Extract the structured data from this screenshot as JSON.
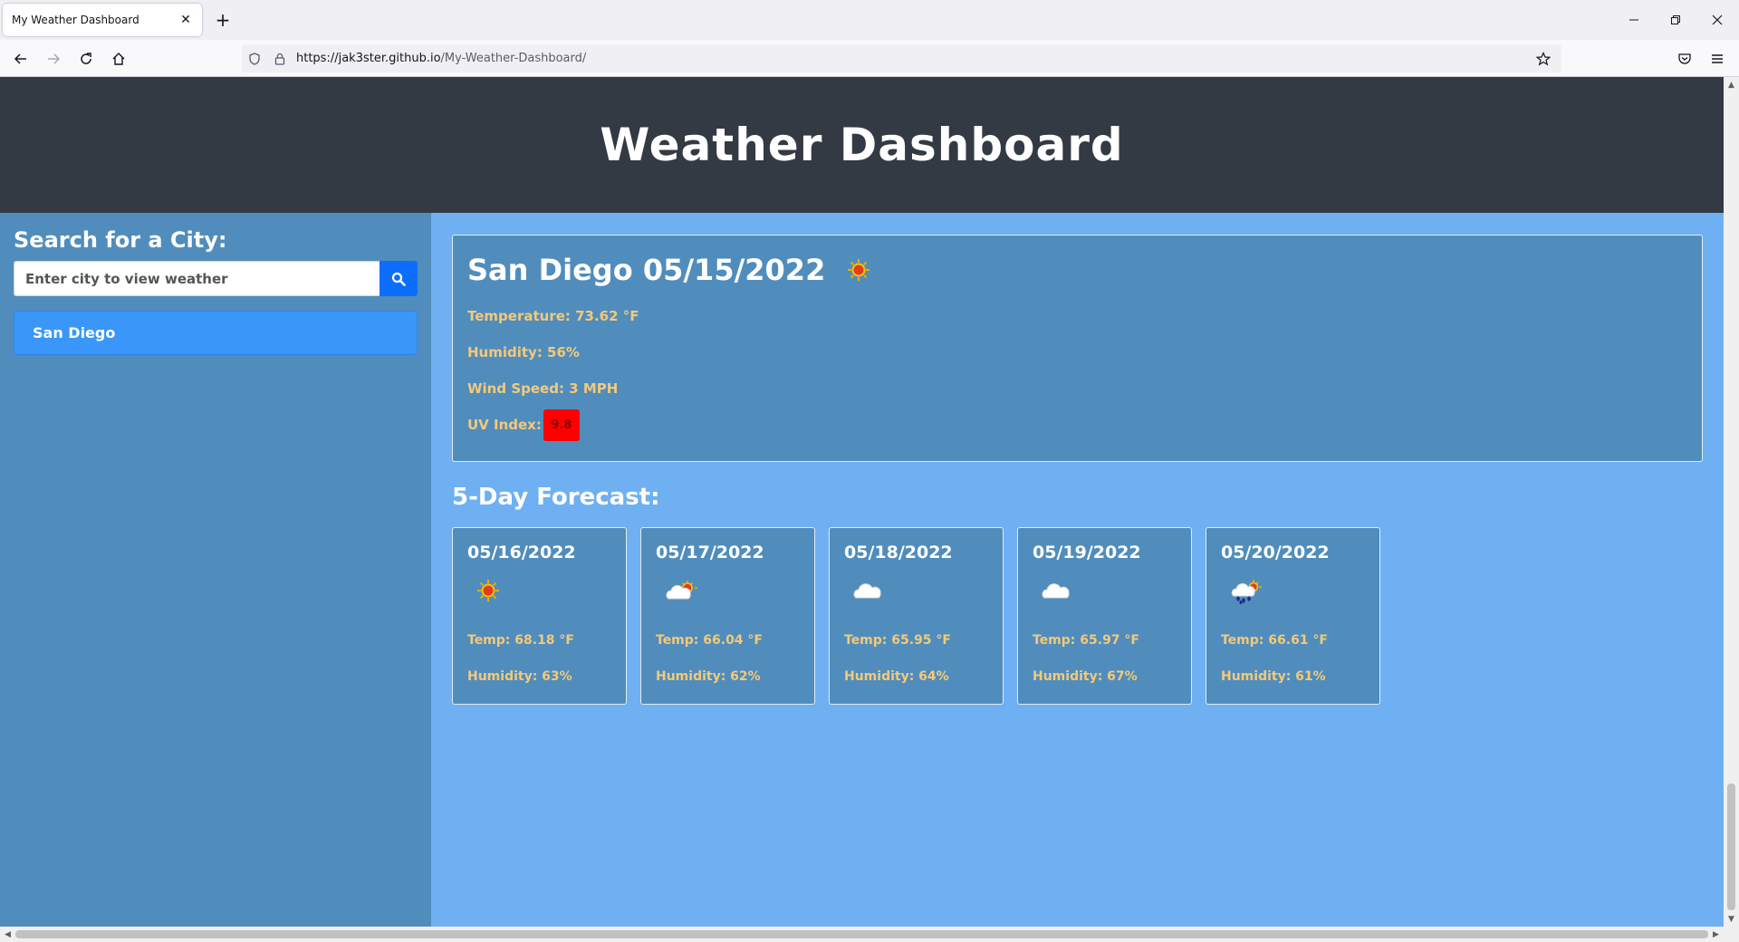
{
  "browser": {
    "tab_title": "My Weather Dashboard",
    "tab_close": "✕",
    "new_tab": "+",
    "url_host": "https://jak3ster.github.io",
    "url_path": "/My-Weather-Dashboard/"
  },
  "header": {
    "title": "Weather Dashboard"
  },
  "sidebar": {
    "heading": "Search for a City:",
    "search_placeholder": "Enter city to view weather",
    "history": [
      "San Diego"
    ]
  },
  "current": {
    "title": "San Diego 05/15/2022",
    "icon": "sun-icon",
    "temperature": "Temperature: 73.62 °F",
    "humidity": "Humidity: 56%",
    "wind": "Wind Speed: 3 MPH",
    "uv_label": "UV Index:",
    "uv_value": "9.8",
    "uv_color": "#ff0000"
  },
  "forecast": {
    "heading": "5-Day Forecast:",
    "days": [
      {
        "date": "05/16/2022",
        "icon": "sun-icon",
        "temp": "Temp: 68.18 °F",
        "humidity": "Humidity: 63%"
      },
      {
        "date": "05/17/2022",
        "icon": "partly-cloudy-icon",
        "temp": "Temp: 66.04 °F",
        "humidity": "Humidity: 62%"
      },
      {
        "date": "05/18/2022",
        "icon": "cloud-icon",
        "temp": "Temp: 65.95 °F",
        "humidity": "Humidity: 64%"
      },
      {
        "date": "05/19/2022",
        "icon": "cloud-icon",
        "temp": "Temp: 65.97 °F",
        "humidity": "Humidity: 67%"
      },
      {
        "date": "05/20/2022",
        "icon": "rain-sun-icon",
        "temp": "Temp: 66.61 °F",
        "humidity": "Humidity: 61%"
      }
    ]
  },
  "colors": {
    "header_bg": "#343a43",
    "sidebar_bg": "#508dbc",
    "main_bg": "#6fb0f2",
    "accent_text": "#f3c97a",
    "history_btn": "#3a97f9",
    "search_btn": "#0d6efd"
  }
}
